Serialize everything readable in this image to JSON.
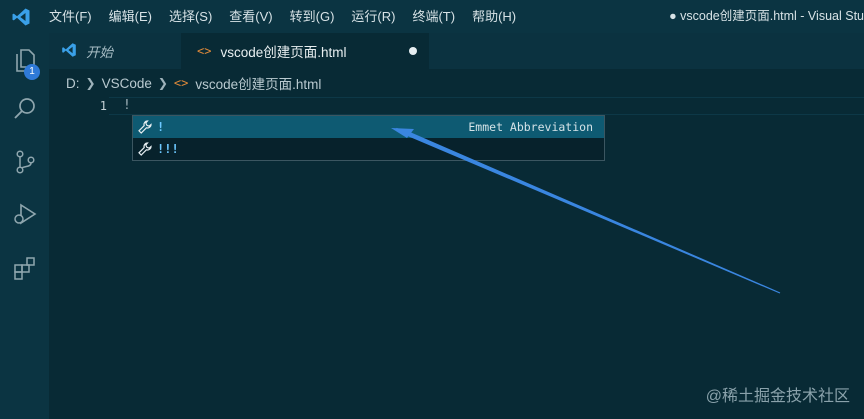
{
  "menu": {
    "items": [
      "文件(F)",
      "编辑(E)",
      "选择(S)",
      "查看(V)",
      "转到(G)",
      "运行(R)",
      "终端(T)",
      "帮助(H)"
    ]
  },
  "window": {
    "title": "● vscode创建页面.html - Visual Stu"
  },
  "activity": {
    "explorer_badge": "1"
  },
  "tabs": [
    {
      "label": "开始",
      "icon": "vscode-logo-icon"
    },
    {
      "label": "vscode创建页面.html",
      "icon": "html-file-icon",
      "dirty": true
    }
  ],
  "breadcrumb": {
    "items": [
      "D:",
      "VSCode",
      "vscode创建页面.html"
    ]
  },
  "editor": {
    "lines": [
      {
        "number": "1",
        "text": "!"
      }
    ]
  },
  "suggest": {
    "items": [
      {
        "label": "!",
        "detail": "Emmet Abbreviation",
        "icon": "wrench-icon",
        "selected": true
      },
      {
        "label": "!!!",
        "icon": "wrench-icon"
      }
    ]
  },
  "watermark": "@稀土掘金技术社区",
  "colors": {
    "background": "#082a35",
    "bars": "#0b3442",
    "selection": "#0e5a72",
    "suggest_label": "#6cc8ff",
    "annotation_arrow": "#3a86e0",
    "badge": "#2f7ad8"
  }
}
